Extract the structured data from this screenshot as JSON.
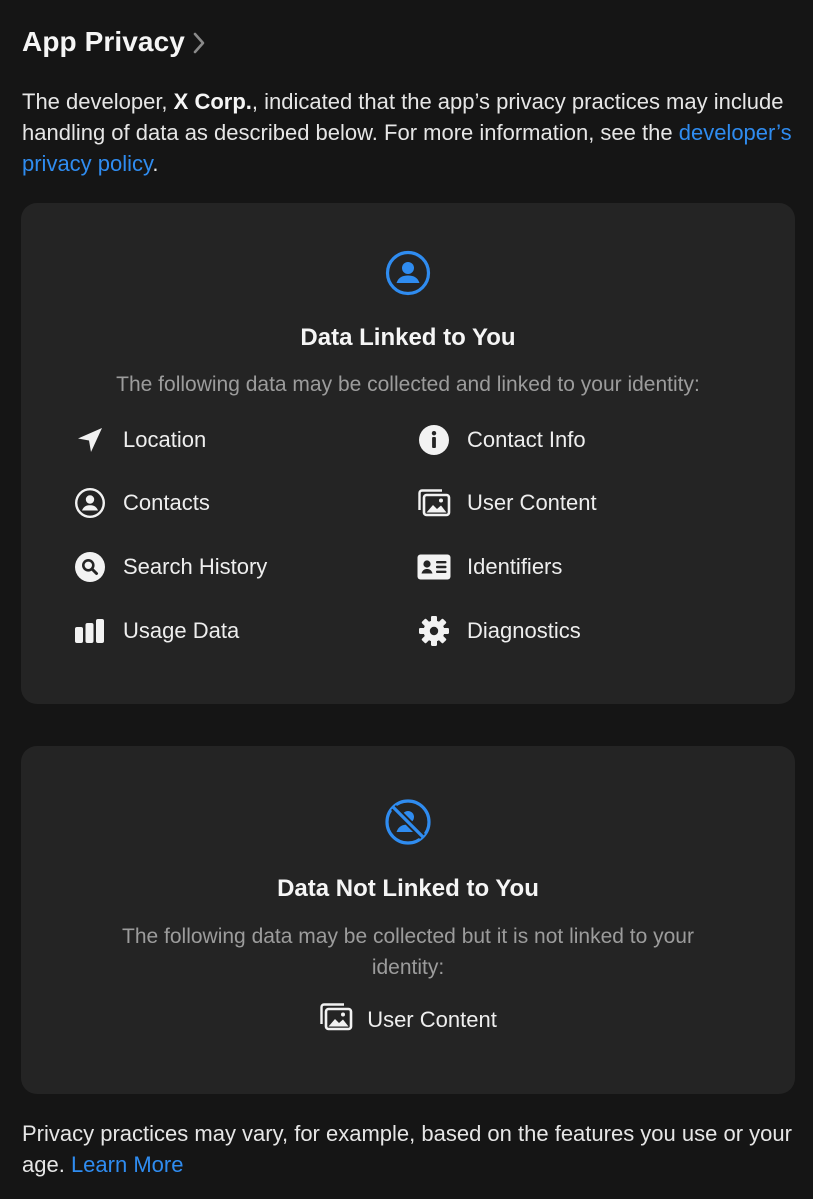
{
  "header": {
    "title": "App Privacy"
  },
  "intro": {
    "prefix": "The developer, ",
    "developer": "X Corp.",
    "middle": ", indicated that the app’s privacy practices may include handling of data as described below. For more information, see the ",
    "link": "developer’s privacy policy",
    "suffix": "."
  },
  "linked": {
    "icon": "person-circle-icon",
    "title": "Data Linked to You",
    "description": "The following data may be collected and linked to your identity:",
    "items": [
      {
        "label": "Location",
        "icon": "location-arrow-icon"
      },
      {
        "label": "Contact Info",
        "icon": "info-circle-icon"
      },
      {
        "label": "Contacts",
        "icon": "person-circle-icon"
      },
      {
        "label": "User Content",
        "icon": "photos-icon"
      },
      {
        "label": "Search History",
        "icon": "search-circle-icon"
      },
      {
        "label": "Identifiers",
        "icon": "id-card-icon"
      },
      {
        "label": "Usage Data",
        "icon": "bar-chart-icon"
      },
      {
        "label": "Diagnostics",
        "icon": "gear-icon"
      }
    ]
  },
  "not_linked": {
    "icon": "person-slash-icon",
    "title": "Data Not Linked to You",
    "description": "The following data may be collected but it is not linked to your identity:",
    "items": [
      {
        "label": "User Content",
        "icon": "photos-icon"
      }
    ]
  },
  "footer": {
    "text": "Privacy practices may vary, for example, based on the features you use or your age. ",
    "link": "Learn More"
  },
  "colors": {
    "background": "#151515",
    "card": "#242424",
    "accent": "#2f8cf0",
    "secondary_text": "#9c9c9c"
  }
}
